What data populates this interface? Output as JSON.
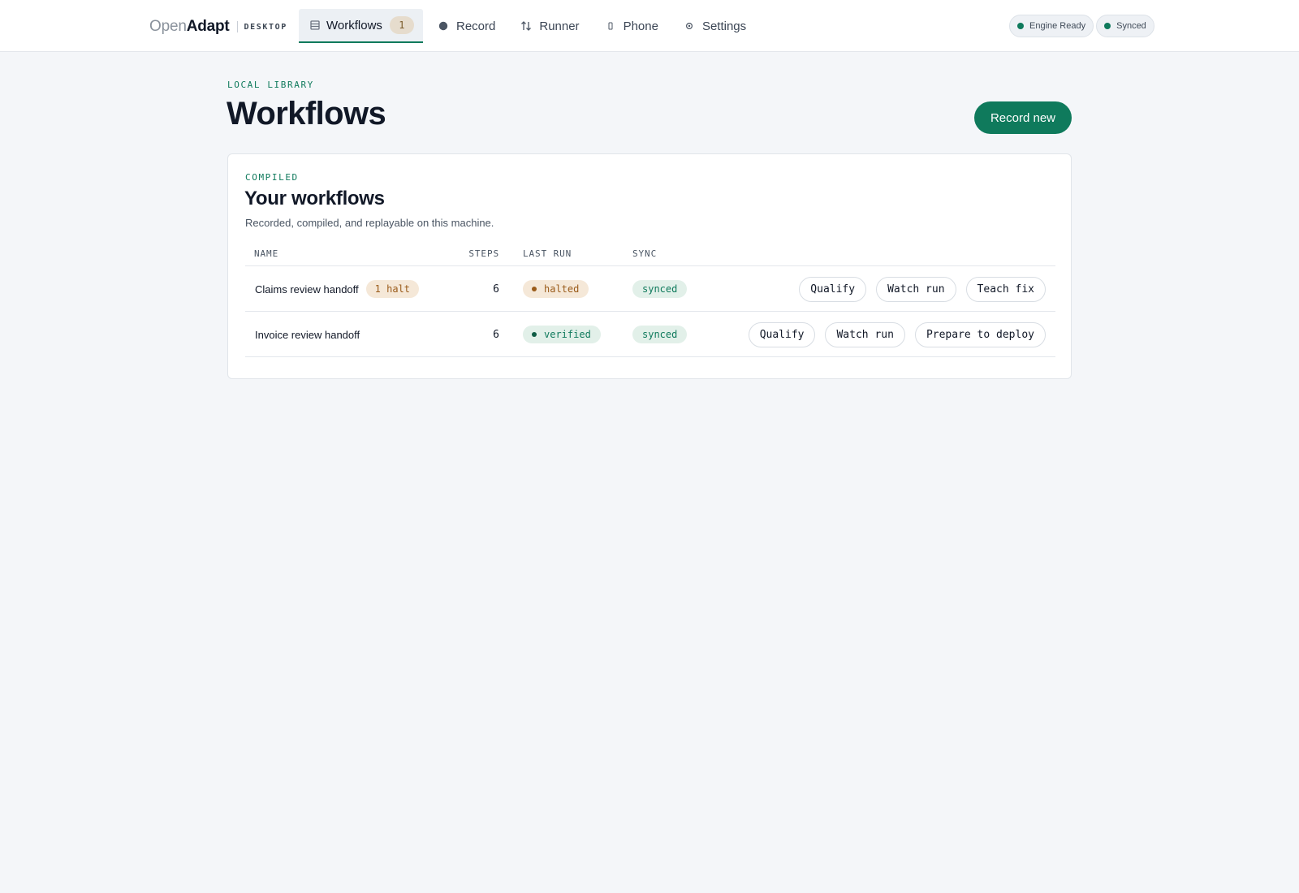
{
  "brand": {
    "name_light": "Open",
    "name_bold": "Adapt",
    "suffix": "DESKTOP"
  },
  "nav": {
    "items": [
      {
        "label": "Workflows",
        "icon": "list-icon",
        "badge": "1",
        "active": true
      },
      {
        "label": "Record",
        "icon": "record-dot-icon"
      },
      {
        "label": "Runner",
        "icon": "swap-arrows-icon"
      },
      {
        "label": "Phone",
        "icon": "phone-icon"
      },
      {
        "label": "Settings",
        "icon": "gear-icon"
      }
    ]
  },
  "status": {
    "engine": "Engine Ready",
    "sync": "Synced",
    "color": "#0f7a5c"
  },
  "header": {
    "eyebrow": "LOCAL LIBRARY",
    "title": "Workflows",
    "primary_action": "Record new"
  },
  "card": {
    "eyebrow": "COMPILED",
    "title": "Your workflows",
    "subtitle": "Recorded, compiled, and replayable on this machine.",
    "columns": {
      "name": "NAME",
      "steps": "STEPS",
      "last_run": "LAST RUN",
      "sync": "SYNC"
    },
    "rows": [
      {
        "name": "Claims review handoff",
        "tag": "1 halt",
        "steps": "6",
        "last_run": "halted",
        "sync": "synced",
        "actions": [
          "Qualify",
          "Watch run",
          "Teach fix"
        ]
      },
      {
        "name": "Invoice review handoff",
        "steps": "6",
        "last_run": "verified",
        "sync": "synced",
        "actions": [
          "Qualify",
          "Watch run",
          "Prepare to deploy"
        ]
      }
    ]
  },
  "colors": {
    "accent": "#0f7a5c",
    "halt": "#9a5b1a",
    "background": "#f4f6f9"
  }
}
